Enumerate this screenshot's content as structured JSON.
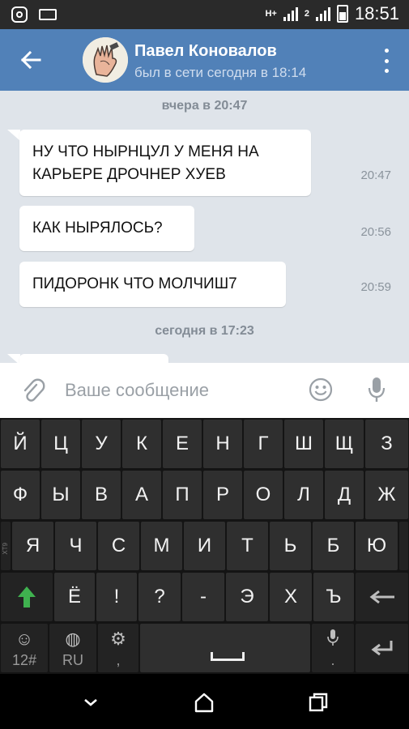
{
  "status_bar": {
    "time": "18:51",
    "network_1": "H+",
    "network_2": "2"
  },
  "header": {
    "contact_name": "Павел Коновалов",
    "last_seen": "был в сети сегодня в 18:14"
  },
  "chat": {
    "day_1": "вчера в 20:47",
    "day_2": "сегодня в 17:23",
    "messages": [
      {
        "line1": "НУ ЧТО НЫРНЦУЛ У МЕНЯ НА",
        "line2": "КАРЬЕРЕ ДРОЧНЕР ХУЕВ",
        "time": "20:47"
      },
      {
        "text": "КАК НЫРЯЛОСЬ?",
        "time": "20:56"
      },
      {
        "text": "ПИДОРОНК ЧТО МОЛЧИШ7",
        "time": "20:59"
      }
    ]
  },
  "composer": {
    "placeholder": "Ваше сообщение"
  },
  "keyboard": {
    "row1": [
      "Й",
      "Ц",
      "У",
      "К",
      "Е",
      "Н",
      "Г",
      "Ш",
      "Щ",
      "З"
    ],
    "row2": [
      "Ф",
      "Ы",
      "В",
      "А",
      "П",
      "Р",
      "О",
      "Л",
      "Д",
      "Ж"
    ],
    "row3": [
      "Я",
      "Ч",
      "С",
      "М",
      "И",
      "Т",
      "Ь",
      "Б",
      "Ю"
    ],
    "row4": [
      "Ё",
      "!",
      "?",
      "-",
      "Э",
      "Х",
      "Ъ"
    ],
    "xt9_label": "XT9",
    "numbers_label": "12#",
    "language_label": "RU",
    "comma_label": ",",
    "period_label": "."
  },
  "colors": {
    "header": "#5181b8",
    "chat_background": "#dfe4ea",
    "shift_arrow": "#3fb24f"
  }
}
